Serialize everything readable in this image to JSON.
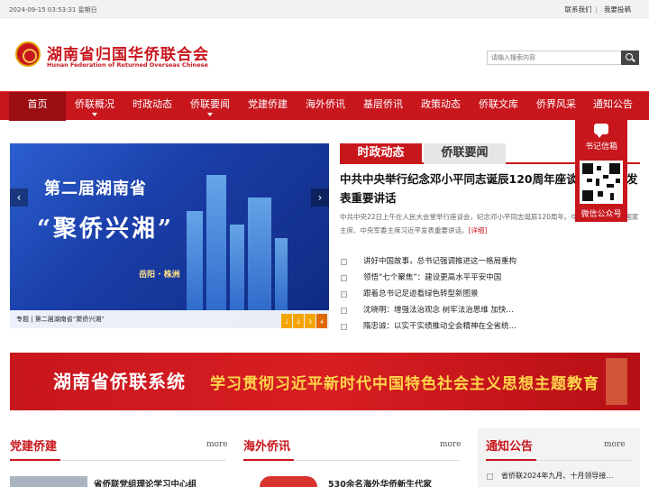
{
  "topbar": {
    "date": "2024-09-15 03:53:31 星期日",
    "contact": "联系我们",
    "sep": "|",
    "submit": "我要投稿"
  },
  "header": {
    "title_cn": "湖南省归国华侨联合会",
    "title_en": "Hunan Federation of Returned Overseas Chinese"
  },
  "search": {
    "placeholder": "请输入搜索内容"
  },
  "nav": [
    "首页",
    "侨联概况",
    "时政动态",
    "侨联要闻",
    "党建侨建",
    "海外侨讯",
    "基层侨讯",
    "政策动态",
    "侨联文库",
    "侨界风采",
    "通知公告"
  ],
  "slider": {
    "title1": "第二届湖南省",
    "title2": "“聚侨兴湘”",
    "place": "岳阳 · 株洲",
    "caption": "专题 | 第二届湖南省“聚侨兴湘”",
    "dots": [
      "1",
      "2",
      "3",
      "4"
    ]
  },
  "news": {
    "tab_active": "时政动态",
    "tab_other": "侨联要闻",
    "headline": "中共中央举行纪念邓小平同志诞辰120周年座谈会 习近平发表重要讲话",
    "summary": "中共中央22日上午在人民大会堂举行座谈会，纪念邓小平同志诞辰120周年。中共中央总书记、国家主席、中央军委主席习近平发表重要讲话。",
    "more": "[详细]",
    "items": [
      "讲好中国故事，总书记强调推进这一格局重构",
      "领悟“七个聚焦”：建设更高水平平安中国",
      "跟着总书记足迹看绿色转型新图景",
      "沈晓明：增强法治观念 树牢法治思维 加快…",
      "隋忠诚：以实干实绩推动全会精神在全省统…"
    ]
  },
  "float": {
    "mail": "书记信箱",
    "wechat": "微信公众号"
  },
  "banner": {
    "left": "湖南省侨联系统",
    "right": "学习贯彻习近平新时代中国特色社会主义思想主题教育"
  },
  "columns": {
    "c1": {
      "title": "党建侨建",
      "more": "more",
      "peek": "省侨联党组理论学习中心组"
    },
    "c2": {
      "title": "海外侨讯",
      "more": "more",
      "peek": "530余名海外华侨新生代家"
    },
    "c3": {
      "title": "通知公告",
      "more": "more",
      "peek": "省侨联2024年九月、十月领导接…"
    }
  },
  "colors": {
    "brand_red": "#c8161d",
    "dark_red": "#9c0d12",
    "gold": "#f3a400"
  }
}
